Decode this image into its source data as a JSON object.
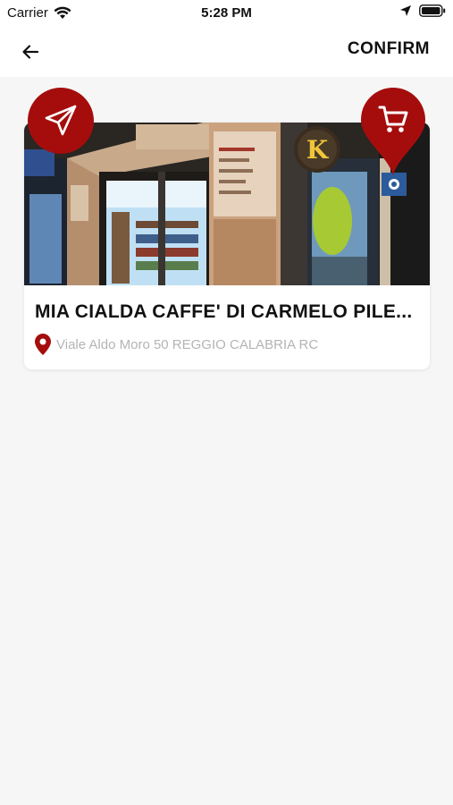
{
  "status_bar": {
    "carrier": "Carrier",
    "time": "5:28 PM"
  },
  "nav": {
    "confirm_label": "CONFIRM"
  },
  "store": {
    "name": "MIA CIALDA CAFFE' DI CARMELO PILE...",
    "address": "Viale Aldo Moro 50 REGGIO CALABRIA RC",
    "sign_logo": "K"
  },
  "icons": {
    "back": "arrow-left-icon",
    "send": "paper-plane-icon",
    "cart": "shopping-cart-icon",
    "location": "map-pin-icon"
  },
  "colors": {
    "accent": "#a50d0d",
    "background": "#f6f6f6",
    "address_text": "#b4b4b4"
  }
}
